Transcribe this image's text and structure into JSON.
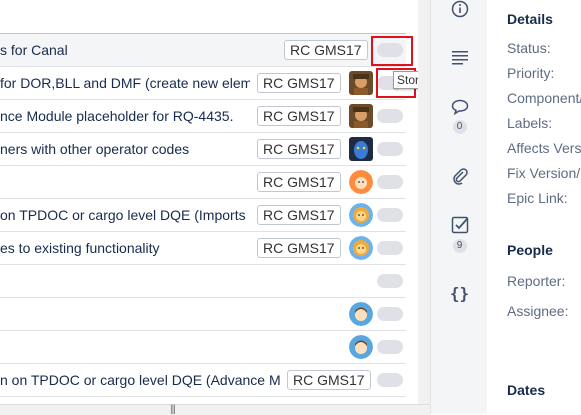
{
  "rows": [
    {
      "title": "s for Canal",
      "version": "RC GMS17",
      "avatar": "none",
      "selected": true
    },
    {
      "title": "for DOR,BLL and DMF (create new elem",
      "version": "RC GMS17",
      "avatar": "warrior"
    },
    {
      "title": "nce Module placeholder for RQ-4435.",
      "version": "RC GMS17",
      "avatar": "warrior"
    },
    {
      "title": "ners with other operator codes",
      "version": "RC GMS17",
      "avatar": "blue-face"
    },
    {
      "title": "",
      "version": "RC GMS17",
      "avatar": "red-hair"
    },
    {
      "title": "on TPDOC or cargo level DQE (Imports",
      "version": "RC GMS17",
      "avatar": "lion"
    },
    {
      "title": "es to existing functionality",
      "version": "RC GMS17",
      "avatar": "lion"
    },
    {
      "title": "",
      "version": "",
      "avatar": "none"
    },
    {
      "title": "",
      "version": "",
      "avatar": "blue-person"
    },
    {
      "title": "",
      "version": "",
      "avatar": "blue-person"
    },
    {
      "title": "n on TPDOC or cargo level DQE (Advance M",
      "version": "RC GMS17",
      "avatar": "none"
    }
  ],
  "tooltip": "Story Points",
  "rail": {
    "comments_count": "0",
    "subtasks_count": "9"
  },
  "details": {
    "heading": "Details",
    "fields": [
      "Status:",
      "Priority:",
      "Component/",
      "Labels:",
      "Affects Vers",
      "Fix Version/",
      "Epic Link:"
    ],
    "people_heading": "People",
    "people_fields": [
      "Reporter:",
      "Assignee:"
    ],
    "dates_heading": "Dates"
  },
  "colors": {
    "highlight": "#e0101c",
    "rail_bg": "#f4f5f7",
    "toggle": "#dfe1e6"
  }
}
